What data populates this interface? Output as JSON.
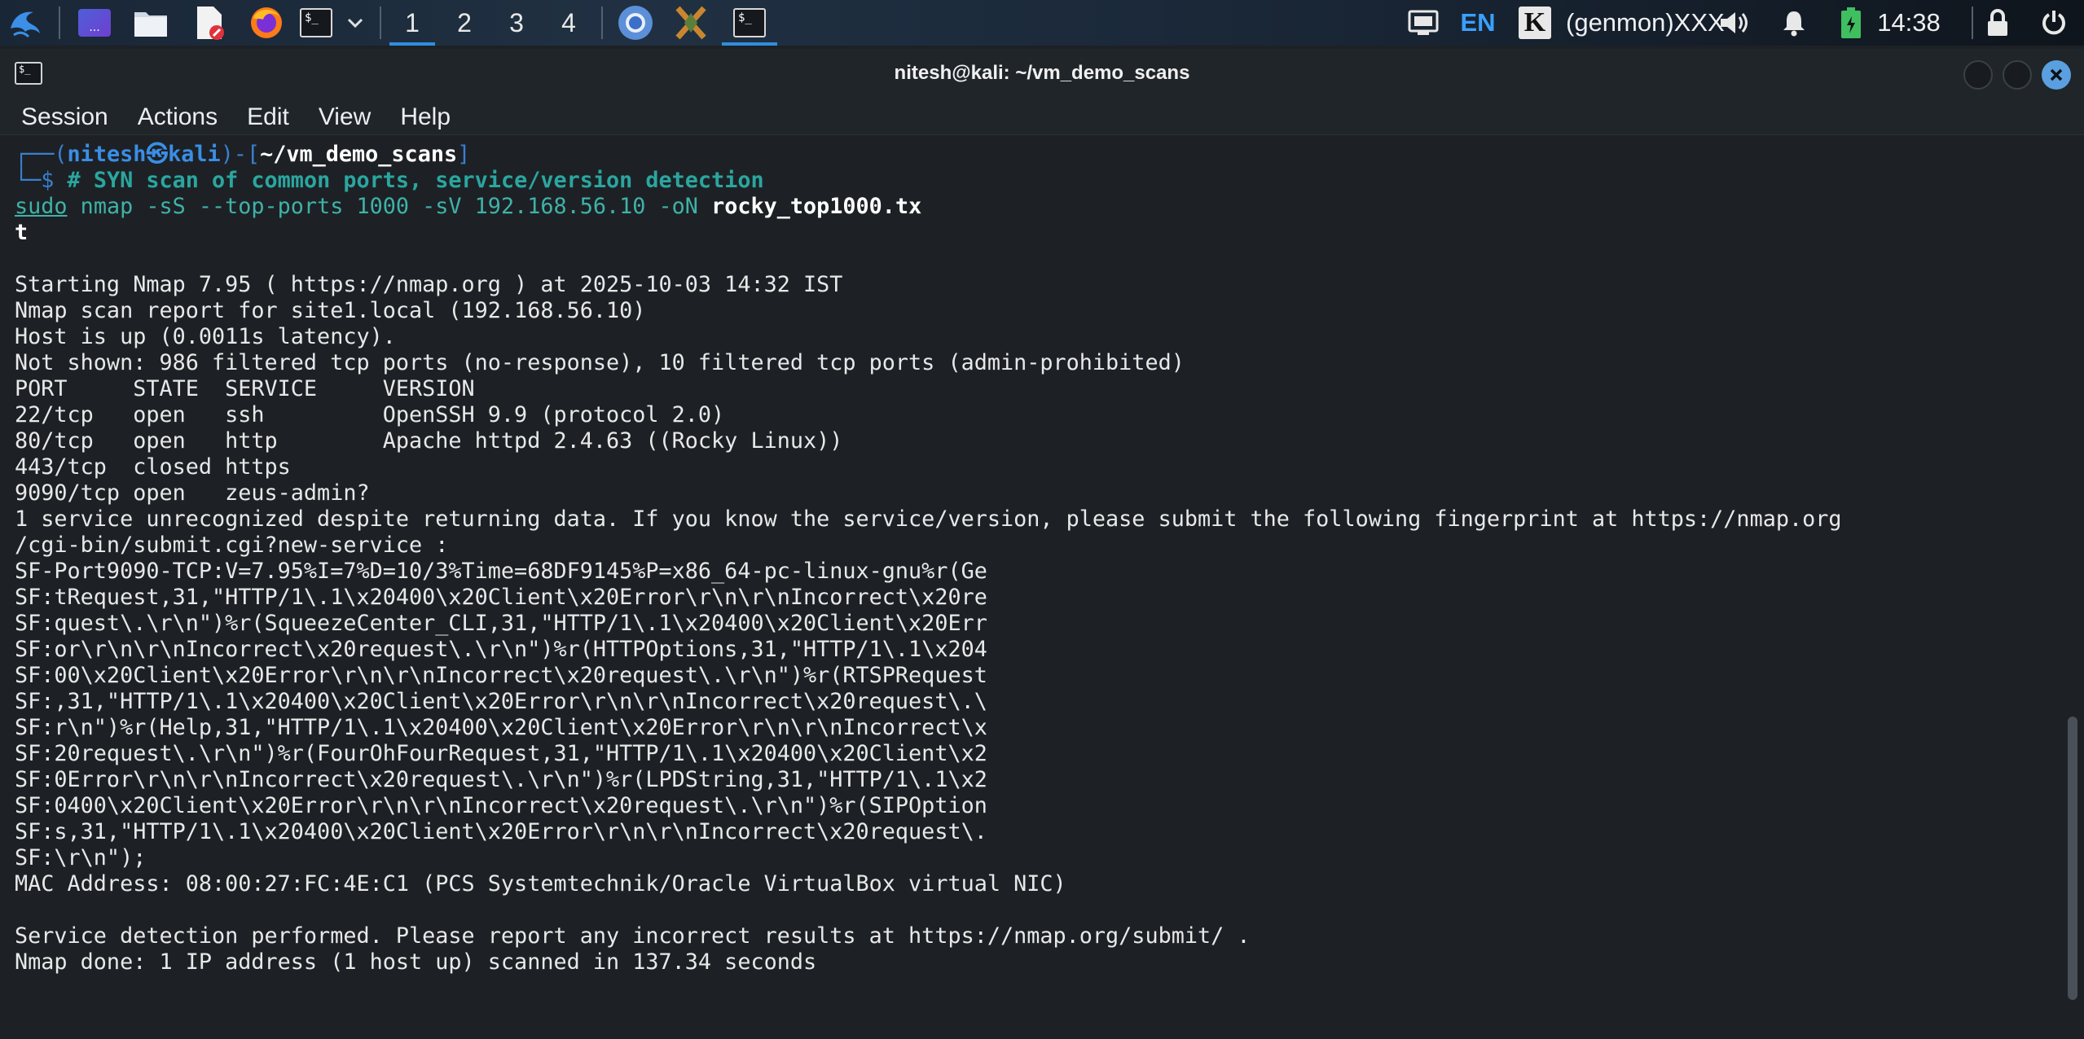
{
  "panel": {
    "workspaces": [
      "1",
      "2",
      "3",
      "4"
    ],
    "active_workspace": "1",
    "keyboard_layout": "EN",
    "genmon_text": "(genmon)XXX",
    "clock": "14:38",
    "app_menu_label": "...",
    "icons": [
      "kali-menu-icon",
      "show-desktop-icon",
      "file-manager-icon",
      "text-editor-icon",
      "firefox-icon",
      "terminal-icon",
      "chevron-down-icon",
      "chromium-icon",
      "burpsuite-icon",
      "terminal-task-icon",
      "screenshot-icon",
      "kali-k-icon",
      "volume-icon",
      "notification-bell-icon",
      "battery-icon",
      "lock-icon",
      "power-icon"
    ]
  },
  "window": {
    "title": "nitesh@kali: ~/vm_demo_scans",
    "menu": [
      "Session",
      "Actions",
      "Edit",
      "View",
      "Help"
    ]
  },
  "terminal": {
    "prompt": {
      "frame_top": "┌──(",
      "user": "nitesh㉿kali",
      "mid": ")-[",
      "dir": "~/vm_demo_scans",
      "end": "]",
      "frame_bottom": "└─$ ",
      "comment": "# SYN scan of common ports, service/version detection"
    },
    "command": {
      "sudo": "sudo",
      "rest": " nmap -sS --top-ports 1000 -sV 192.168.56.10 -oN ",
      "file": "rocky_top1000.tx",
      "wrap": "t"
    },
    "output": [
      "",
      "Starting Nmap 7.95 ( https://nmap.org ) at 2025-10-03 14:32 IST",
      "Nmap scan report for site1.local (192.168.56.10)",
      "Host is up (0.0011s latency).",
      "Not shown: 986 filtered tcp ports (no-response), 10 filtered tcp ports (admin-prohibited)",
      "PORT     STATE  SERVICE     VERSION",
      "22/tcp   open   ssh         OpenSSH 9.9 (protocol 2.0)",
      "80/tcp   open   http        Apache httpd 2.4.63 ((Rocky Linux))",
      "443/tcp  closed https",
      "9090/tcp open   zeus-admin?",
      "1 service unrecognized despite returning data. If you know the service/version, please submit the following fingerprint at https://nmap.org",
      "/cgi-bin/submit.cgi?new-service :",
      "SF-Port9090-TCP:V=7.95%I=7%D=10/3%Time=68DF9145%P=x86_64-pc-linux-gnu%r(Ge",
      "SF:tRequest,31,\"HTTP/1\\.1\\x20400\\x20Client\\x20Error\\r\\n\\r\\nIncorrect\\x20re",
      "SF:quest\\.\\r\\n\")%r(SqueezeCenter_CLI,31,\"HTTP/1\\.1\\x20400\\x20Client\\x20Err",
      "SF:or\\r\\n\\r\\nIncorrect\\x20request\\.\\r\\n\")%r(HTTPOptions,31,\"HTTP/1\\.1\\x204",
      "SF:00\\x20Client\\x20Error\\r\\n\\r\\nIncorrect\\x20request\\.\\r\\n\")%r(RTSPRequest",
      "SF:,31,\"HTTP/1\\.1\\x20400\\x20Client\\x20Error\\r\\n\\r\\nIncorrect\\x20request\\.\\",
      "SF:r\\n\")%r(Help,31,\"HTTP/1\\.1\\x20400\\x20Client\\x20Error\\r\\n\\r\\nIncorrect\\x",
      "SF:20request\\.\\r\\n\")%r(FourOhFourRequest,31,\"HTTP/1\\.1\\x20400\\x20Client\\x2",
      "SF:0Error\\r\\n\\r\\nIncorrect\\x20request\\.\\r\\n\")%r(LPDString,31,\"HTTP/1\\.1\\x2",
      "SF:0400\\x20Client\\x20Error\\r\\n\\r\\nIncorrect\\x20request\\.\\r\\n\")%r(SIPOption",
      "SF:s,31,\"HTTP/1\\.1\\x20400\\x20Client\\x20Error\\r\\n\\r\\nIncorrect\\x20request\\.",
      "SF:\\r\\n\");",
      "MAC Address: 08:00:27:FC:4E:C1 (PCS Systemtechnik/Oracle VirtualBox virtual NIC)",
      "",
      "Service detection performed. Please report any incorrect results at https://nmap.org/submit/ .",
      "Nmap done: 1 IP address (1 host up) scanned in 137.34 seconds"
    ]
  },
  "colors": {
    "panel_accent": "#2f8ee0",
    "terminal_bg": "#1d2125",
    "prompt_frame": "#3a7fd0",
    "prompt_comment": "#2aa69f",
    "close_button": "#5aa0e0"
  }
}
